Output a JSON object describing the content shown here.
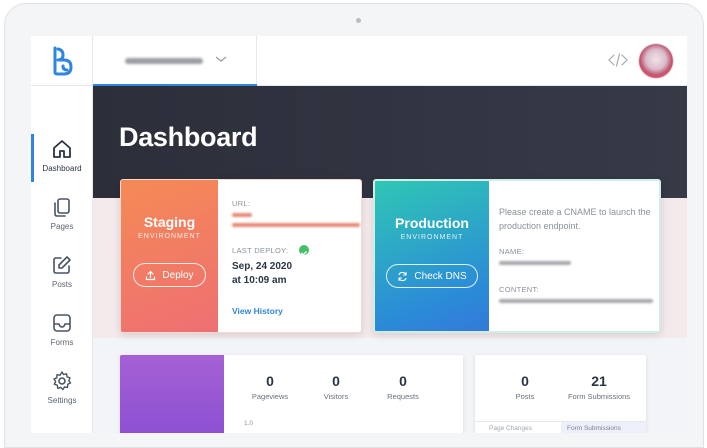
{
  "topbar": {
    "site_selector": {
      "icon": "chevron-down-icon"
    },
    "code_icon": "code-icon"
  },
  "sidebar": {
    "items": [
      {
        "label": "Dashboard",
        "icon": "home-icon",
        "active": true
      },
      {
        "label": "Pages",
        "icon": "pages-icon",
        "active": false
      },
      {
        "label": "Posts",
        "icon": "edit-icon",
        "active": false
      },
      {
        "label": "Forms",
        "icon": "inbox-icon",
        "active": false
      },
      {
        "label": "Settings",
        "icon": "gear-icon",
        "active": false
      }
    ]
  },
  "hero": {
    "title": "Dashboard"
  },
  "staging": {
    "name": "Staging",
    "subtitle": "ENVIRONMENT",
    "deploy_label": "Deploy",
    "url_label": "URL:",
    "last_deploy_label": "LAST DEPLOY:",
    "last_deploy_date": "Sep, 24 2020",
    "last_deploy_time": "at 10:09 am",
    "history_link": "View History"
  },
  "production": {
    "name": "Production",
    "subtitle": "ENVIRONMENT",
    "check_dns_label": "Check DNS",
    "message": "Please create a CNAME to launch the production endpoint.",
    "name_label": "NAME:",
    "content_label": "CONTENT:"
  },
  "traffic": {
    "stats": [
      {
        "value": "0",
        "label": "Pageviews"
      },
      {
        "value": "0",
        "label": "Visitors"
      },
      {
        "value": "0",
        "label": "Requests"
      }
    ],
    "chart_tick": "1.0"
  },
  "content_stats": {
    "stats": [
      {
        "value": "0",
        "label": "Posts"
      },
      {
        "value": "21",
        "label": "Form Submissions"
      }
    ],
    "tabs": [
      "Page Changes",
      "Form Submissions"
    ]
  },
  "colors": {
    "accent": "#2e86de",
    "hero_bg": "#2c2f3a",
    "staging_gradient": [
      "#f58a55",
      "#ee6f73"
    ],
    "production_gradient": [
      "#2fc7b4",
      "#2b8ad8"
    ],
    "traffic_header": "#a561d4"
  }
}
